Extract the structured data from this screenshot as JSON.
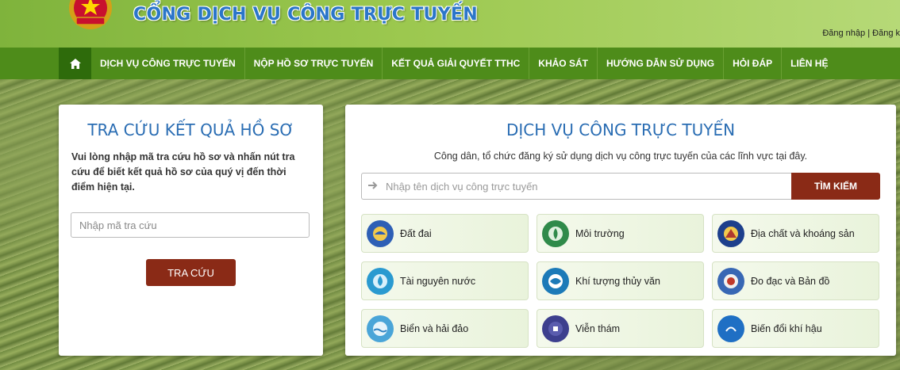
{
  "header": {
    "site_title": "CỔNG DỊCH VỤ CÔNG TRỰC TUYẾN",
    "login": "Đăng nhập",
    "separator": "|",
    "register": "Đăng k"
  },
  "nav": {
    "home_icon": "home-icon",
    "items": [
      {
        "label": "DỊCH VỤ CÔNG TRỰC TUYẾN"
      },
      {
        "label": "NỘP HỒ SƠ TRỰC TUYẾN"
      },
      {
        "label": "KẾT QUẢ GIẢI QUYẾT TTHC"
      },
      {
        "label": "KHẢO SÁT"
      },
      {
        "label": "HƯỚNG DẪN SỬ DỤNG"
      },
      {
        "label": "HỎI ĐÁP"
      },
      {
        "label": "LIÊN HỆ"
      }
    ]
  },
  "lookup": {
    "title": "TRA CỨU KẾT QUẢ HỒ SƠ",
    "description": "Vui lòng nhập mã tra cứu hồ sơ và nhấn nút tra cứu để biết kết quả hồ sơ của quý vị đến thời điểm hiện tại.",
    "input_placeholder": "Nhập mã tra cứu",
    "input_value": "",
    "button_label": "TRA CỨU"
  },
  "services": {
    "title": "DỊCH VỤ CÔNG TRỰC TUYẾN",
    "subtitle": "Công dân, tổ chức đăng ký sử dụng dịch vụ công trực tuyến của các lĩnh vực tại đây.",
    "search_placeholder": "Nhập tên dịch vụ công trực tuyến",
    "search_value": "",
    "search_button": "TÌM KIẾM",
    "categories": [
      {
        "label": "Đất đai",
        "icon": "land-icon",
        "color": "#2e5fb5"
      },
      {
        "label": "Môi trường",
        "icon": "environment-icon",
        "color": "#2f8a4a"
      },
      {
        "label": "Địa chất và khoáng sản",
        "icon": "geology-icon",
        "color": "#1d3f8c"
      },
      {
        "label": "Tài nguyên nước",
        "icon": "water-resource-icon",
        "color": "#2a9ad0"
      },
      {
        "label": "Khí tượng thủy văn",
        "icon": "meteorology-icon",
        "color": "#1c7ab8"
      },
      {
        "label": "Đo đạc và Bản đồ",
        "icon": "survey-map-icon",
        "color": "#3867b4"
      },
      {
        "label": "Biển và hải đảo",
        "icon": "sea-island-icon",
        "color": "#4aa5d8"
      },
      {
        "label": "Viễn thám",
        "icon": "remote-sensing-icon",
        "color": "#3d3f8e"
      },
      {
        "label": "Biến đổi khí hậu",
        "icon": "climate-change-icon",
        "color": "#1f6fc4"
      }
    ]
  },
  "colors": {
    "nav_bg": "#4e8c1a",
    "button_bg": "#8a2a16",
    "title_blue": "#2a6db3"
  }
}
